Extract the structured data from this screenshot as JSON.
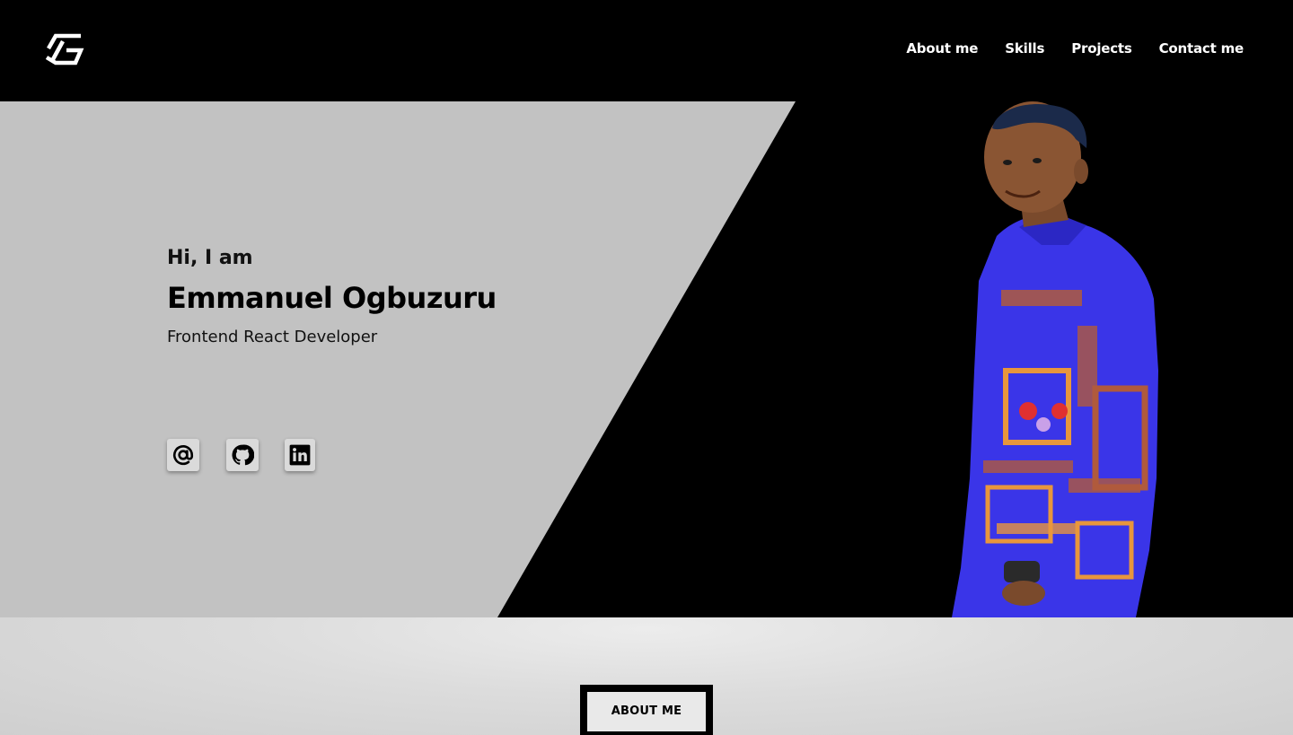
{
  "header": {
    "logo_icon": "tg-monogram-logo",
    "nav": [
      {
        "label": "About me"
      },
      {
        "label": "Skills"
      },
      {
        "label": "Projects"
      },
      {
        "label": "Contact me"
      }
    ]
  },
  "hero": {
    "greeting": "Hi, I am",
    "name": "Emmanuel Ogbuzuru",
    "role": "Frontend React Developer",
    "socials": [
      {
        "icon": "at-sign-icon"
      },
      {
        "icon": "github-icon"
      },
      {
        "icon": "linkedin-icon"
      }
    ],
    "colors": {
      "panel": "#c2c2c2",
      "background": "#000000",
      "shirt": "#3a35e8"
    }
  },
  "about_section": {
    "button_label": "ABOUT ME"
  }
}
